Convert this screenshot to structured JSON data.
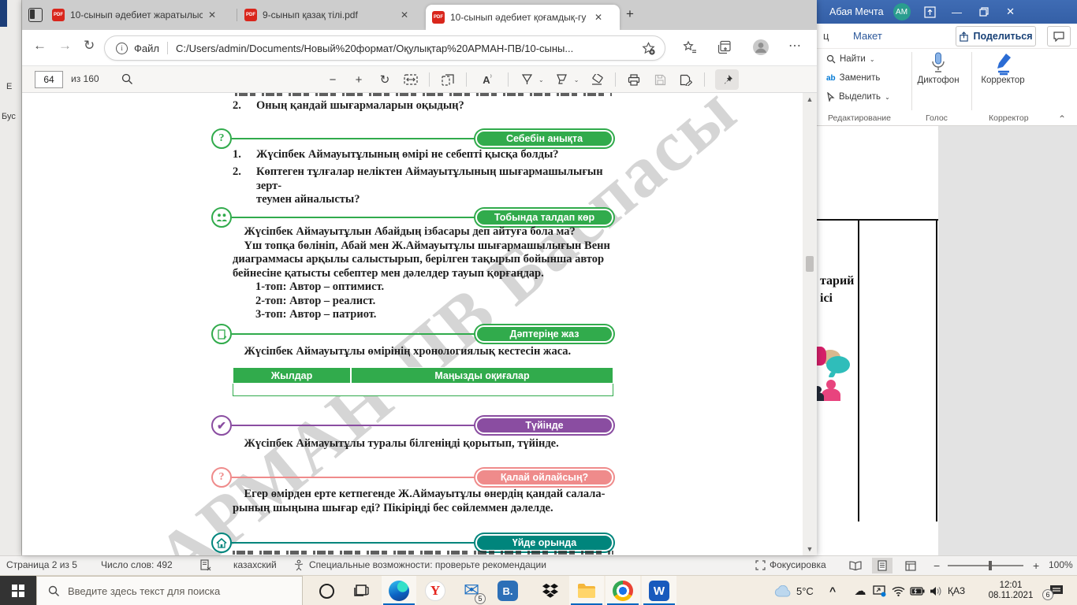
{
  "backdrop": {
    "labels": [
      "Е",
      "Бус"
    ]
  },
  "edge": {
    "tabs": [
      {
        "title": "10-сынып әдебиет жаратылыст"
      },
      {
        "title": "9-сынып қазақ тілі.pdf"
      },
      {
        "title": "10-сынып әдебиет қоғамдық-гу"
      }
    ],
    "nav": {
      "file_label": "Файл",
      "url": "C:/Users/admin/Documents/Новый%20формат/Оқулықтар%20АРМАН-ПВ/10-сыны..."
    },
    "pdfbar": {
      "page": "64",
      "of": "из 160"
    }
  },
  "pdf": {
    "watermark": "АРМАН-ПВ Баспасы",
    "intro": {
      "num": "2.",
      "text": "Оның қандай шығармаларын оқыдың?"
    },
    "sections": [
      {
        "banner": "Себебін анықта",
        "color": "#31ab4c",
        "items": [
          {
            "num": "1.",
            "text": "Жүсіпбек Аймауытұлының өмірі не себепті қысқа болды?"
          },
          {
            "num": "2.",
            "text": "Көптеген тұлғалар неліктен Аймауытұлының шығармашылығын зерт-\nтеумен айналысты?"
          }
        ]
      },
      {
        "banner": "Тобында талдап көр",
        "color": "#31ab4c",
        "paragraph": " Жүсіпбек Аймауытұлын Абайдың ізбасары деп айтуға бола ма?\n Үш топқа бөлініп, Абай мен Ж.Аймауытұлы шығармашылығын Венн\nдиаграммасы арқылы салыстырып, берілген тақырып бойынша автор\nбейнесіне қатысты себептер мен дәлелдер тауып қорғаңдар.\n  1-топ: Автор – оптимист.\n  2-топ: Автор – реалист.\n  3-топ: Автор – патриот."
      },
      {
        "banner": "Дәптеріңе жаз",
        "color": "#31ab4c",
        "paragraph": " Жүсіпбек Аймауытұлы өмірінің хронологиялық кестесін жаса.",
        "table_headers": [
          "Жылдар",
          "Маңызды оқиғалар"
        ]
      },
      {
        "banner": "Түйінде",
        "color": "#8a4da1",
        "paragraph": " Жүсіпбек Аймауытұлы туралы білгеніңді қорытып, түйінде."
      },
      {
        "banner": "Қалай ойлайсың?",
        "color": "#ef8b8b",
        "paragraph": " Егер өмірден ерте кетпегенде Ж.Аймауытұлы өнердің қандай салала-\nрының шыңына шығар еді? Пікіріңді бес сөйлеммен дәлелде."
      },
      {
        "banner": "Үйде орында",
        "color": "#00857c"
      }
    ]
  },
  "word": {
    "titlebar": {
      "account": "Абая Мечта",
      "avatar": "AM"
    },
    "menu": {
      "partial": "ц",
      "tab": "Макет",
      "share": "Поделиться"
    },
    "ribbon": {
      "find": "Найти",
      "replace": "Заменить",
      "select": "Выделить",
      "dictate": "Диктофон",
      "editor": "Корректор",
      "groups": [
        "Редактирование",
        "Голос",
        "Корректор"
      ]
    },
    "document": {
      "lines": [
        "тарий",
        "ісі"
      ]
    },
    "status": {
      "page": "Страница 2 из 5",
      "words": "Число слов: 492",
      "language": "казахский",
      "accessibility": "Специальные возможности: проверьте рекомендации",
      "focus": "Фокусировка",
      "zoom": "100%"
    }
  },
  "taskbar": {
    "search_placeholder": "Введите здесь текст для поиска",
    "weather": "5°C",
    "lang": "ҚАЗ",
    "time": "12:01",
    "date": "08.11.2021",
    "mail_badge": "5",
    "notif_badge": "6"
  }
}
